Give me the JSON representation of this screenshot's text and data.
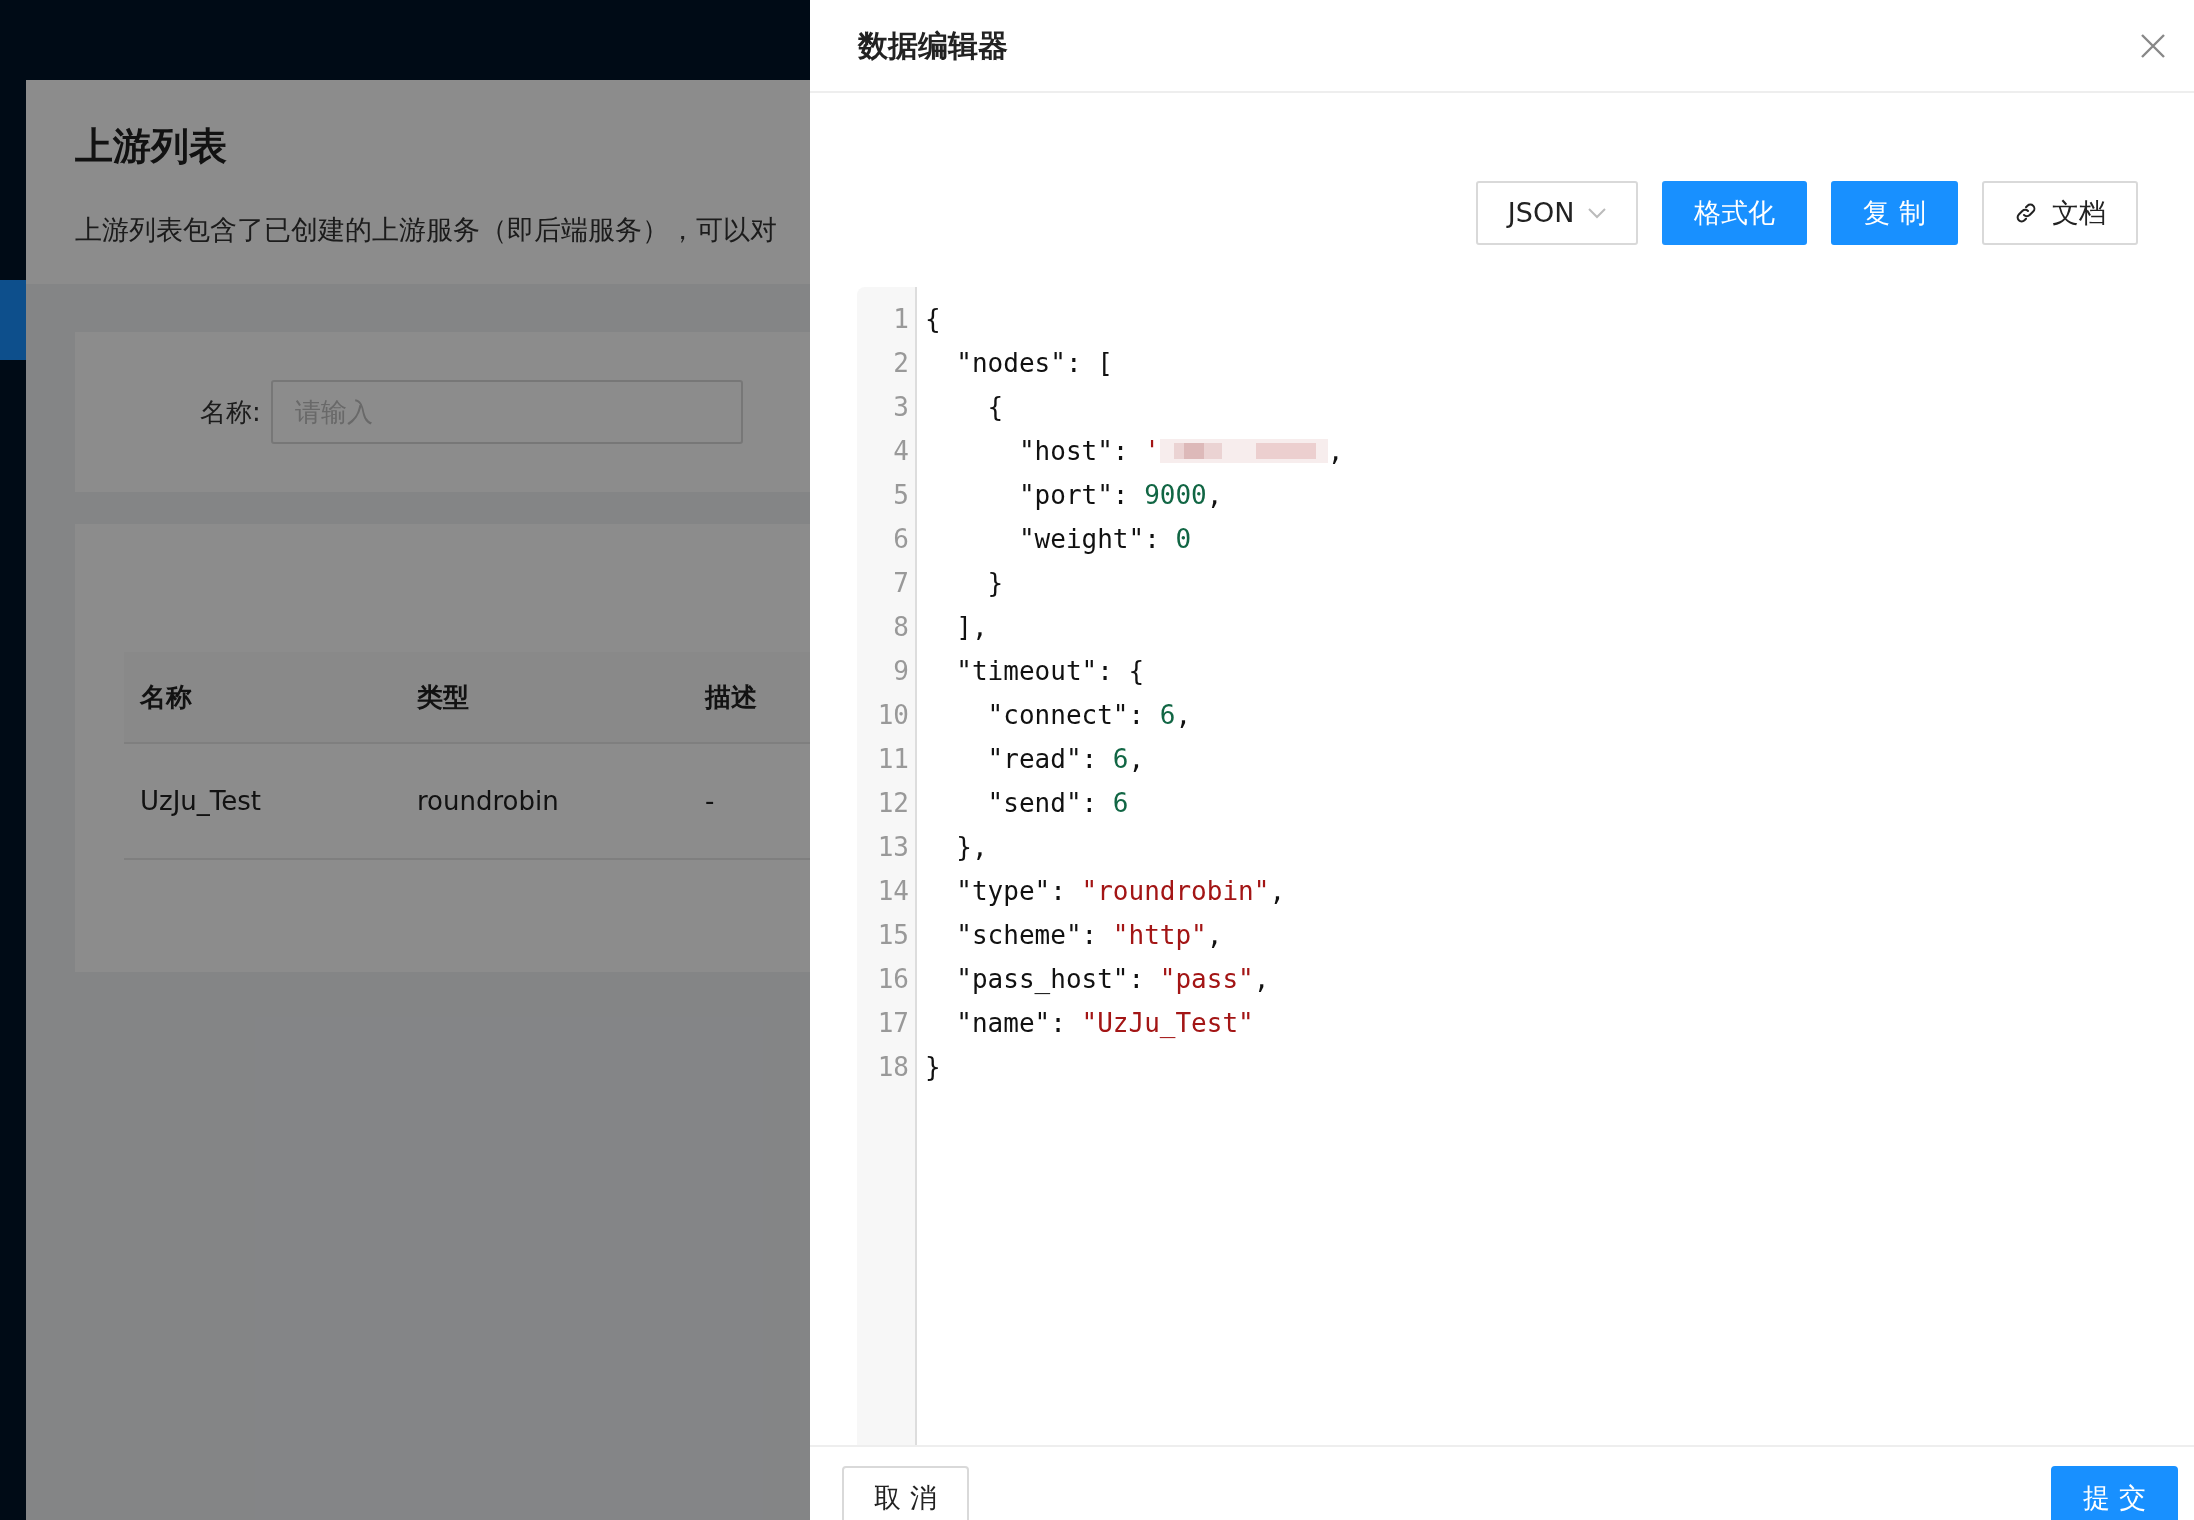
{
  "page": {
    "title": "上游列表",
    "description": "上游列表包含了已创建的上游服务（即后端服务），可以对",
    "search": {
      "label": "名称:",
      "placeholder": "请输入"
    },
    "table": {
      "columns": [
        "名称",
        "类型",
        "描述"
      ],
      "rows": [
        [
          "UzJu_Test",
          "roundrobin",
          "-"
        ]
      ]
    }
  },
  "drawer": {
    "title": "数据编辑器",
    "toolbar": [
      {
        "kind": "select",
        "label": "JSON"
      },
      {
        "kind": "primary",
        "label": "格式化"
      },
      {
        "kind": "primary",
        "label": "复 制"
      },
      {
        "kind": "link",
        "label": "文档"
      }
    ],
    "code": [
      [
        {
          "kind": "plain",
          "text": "{"
        }
      ],
      [
        {
          "kind": "plain",
          "text": "  \"nodes\": ["
        }
      ],
      [
        {
          "kind": "plain",
          "text": "    {"
        }
      ],
      [
        {
          "kind": "plain",
          "text": "      \"host\": "
        },
        {
          "kind": "string",
          "text": "'"
        },
        {
          "kind": "redacted"
        },
        {
          "kind": "plain",
          "text": ","
        }
      ],
      [
        {
          "kind": "plain",
          "text": "      \"port\": "
        },
        {
          "kind": "number",
          "text": "9000"
        },
        {
          "kind": "plain",
          "text": ","
        }
      ],
      [
        {
          "kind": "plain",
          "text": "      \"weight\": "
        },
        {
          "kind": "number",
          "text": "0"
        }
      ],
      [
        {
          "kind": "plain",
          "text": "    }"
        }
      ],
      [
        {
          "kind": "plain",
          "text": "  ],"
        }
      ],
      [
        {
          "kind": "plain",
          "text": "  \"timeout\": {"
        }
      ],
      [
        {
          "kind": "plain",
          "text": "    \"connect\": "
        },
        {
          "kind": "number",
          "text": "6"
        },
        {
          "kind": "plain",
          "text": ","
        }
      ],
      [
        {
          "kind": "plain",
          "text": "    \"read\": "
        },
        {
          "kind": "number",
          "text": "6"
        },
        {
          "kind": "plain",
          "text": ","
        }
      ],
      [
        {
          "kind": "plain",
          "text": "    \"send\": "
        },
        {
          "kind": "number",
          "text": "6"
        }
      ],
      [
        {
          "kind": "plain",
          "text": "  },"
        }
      ],
      [
        {
          "kind": "plain",
          "text": "  \"type\": "
        },
        {
          "kind": "string",
          "text": "\"roundrobin\""
        },
        {
          "kind": "plain",
          "text": ","
        }
      ],
      [
        {
          "kind": "plain",
          "text": "  \"scheme\": "
        },
        {
          "kind": "string",
          "text": "\"http\""
        },
        {
          "kind": "plain",
          "text": ","
        }
      ],
      [
        {
          "kind": "plain",
          "text": "  \"pass_host\": "
        },
        {
          "kind": "string",
          "text": "\"pass\""
        },
        {
          "kind": "plain",
          "text": ","
        }
      ],
      [
        {
          "kind": "plain",
          "text": "  \"name\": "
        },
        {
          "kind": "string",
          "text": "\"UzJu_Test\""
        }
      ],
      [
        {
          "kind": "plain",
          "text": "}"
        }
      ]
    ],
    "line_numbers": [
      "1",
      "2",
      "3",
      "4",
      "5",
      "6",
      "7",
      "8",
      "9",
      "10",
      "11",
      "12",
      "13",
      "14",
      "15",
      "16",
      "17",
      "18"
    ],
    "footer": [
      {
        "kind": "default",
        "label": "取 消"
      },
      {
        "kind": "primary",
        "label": "提 交"
      }
    ]
  }
}
